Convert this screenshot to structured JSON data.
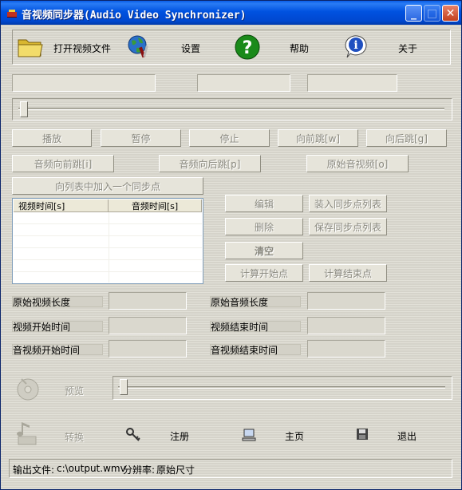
{
  "window": {
    "title": "音视频同步器(Audio Video Synchronizer)",
    "controls": {
      "minimize": "_",
      "maximize": "□",
      "close": "✕"
    }
  },
  "toolbar": {
    "open_video": "打开视频文件",
    "settings": "设置",
    "help": "帮助",
    "about": "关于"
  },
  "icons": {
    "open": "folder-icon",
    "settings": "globe-tools-icon",
    "help": "question-icon",
    "about": "info-icon",
    "preview": "disc-icon",
    "convert": "music-note-icon",
    "register": "key-icon",
    "home": "computer-icon",
    "exit": "floppy-icon"
  },
  "playback": {
    "play": "播放",
    "pause": "暂停",
    "stop": "停止",
    "jump_forward": "向前跳[w]",
    "jump_backward": "向后跳[g]",
    "audio_jump_forward": "音频向前跳[i]",
    "audio_jump_backward": "音频向后跳[p]",
    "original_av": "原始音视频[o]"
  },
  "sync": {
    "add_point": "向列表中加入一个同步点",
    "columns": [
      "视频时间[s]",
      "音频时间[s]"
    ],
    "rows": [],
    "edit": "编辑",
    "load_list": "装入同步点列表",
    "delete": "删除",
    "save_list": "保存同步点列表",
    "clear": "清空",
    "calc_start": "计算开始点",
    "calc_end": "计算结束点"
  },
  "info": {
    "orig_video_len": "原始视频长度",
    "orig_audio_len": "原始音频长度",
    "video_start": "视频开始时间",
    "video_end": "视频结束时间",
    "av_start": "音视频开始时间",
    "av_end": "音视频结束时间"
  },
  "bottom": {
    "preview": "预览",
    "convert": "转换",
    "register": "注册",
    "home": "主页",
    "exit": "退出"
  },
  "status": {
    "output_label": "输出文件:",
    "output_value": "c:\\output.wmv",
    "resolution_label": "分辨率:",
    "resolution_value": "原始尺寸"
  },
  "colors": {
    "titlebar": "#0054e3",
    "background": "#dcdad0",
    "disabled_text": "#8a897f",
    "help_green": "#1a8a1a",
    "info_blue": "#2050c0"
  }
}
